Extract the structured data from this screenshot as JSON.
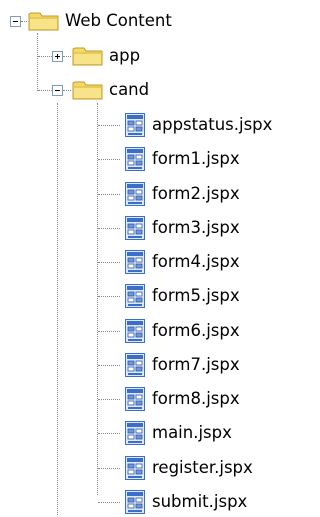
{
  "tree": {
    "root": {
      "label": "Web Content",
      "icon": "folder-icon",
      "state": "expanded"
    },
    "folders": [
      {
        "label": "app",
        "icon": "folder-icon",
        "state": "collapsed"
      },
      {
        "label": "cand",
        "icon": "folder-icon",
        "state": "expanded"
      }
    ],
    "files": [
      {
        "label": "appstatus.jspx",
        "icon": "jspx-file-icon"
      },
      {
        "label": "form1.jspx",
        "icon": "jspx-file-icon"
      },
      {
        "label": "form2.jspx",
        "icon": "jspx-file-icon"
      },
      {
        "label": "form3.jspx",
        "icon": "jspx-file-icon"
      },
      {
        "label": "form4.jspx",
        "icon": "jspx-file-icon"
      },
      {
        "label": "form5.jspx",
        "icon": "jspx-file-icon"
      },
      {
        "label": "form6.jspx",
        "icon": "jspx-file-icon"
      },
      {
        "label": "form7.jspx",
        "icon": "jspx-file-icon"
      },
      {
        "label": "form8.jspx",
        "icon": "jspx-file-icon"
      },
      {
        "label": "main.jspx",
        "icon": "jspx-file-icon"
      },
      {
        "label": "register.jspx",
        "icon": "jspx-file-icon"
      },
      {
        "label": "submit.jspx",
        "icon": "jspx-file-icon"
      }
    ]
  },
  "colors": {
    "folder": "#f3d86a",
    "folder_outline": "#c19a2b",
    "file_blue": "#3a6fc9",
    "connector": "#8a8a8a"
  }
}
